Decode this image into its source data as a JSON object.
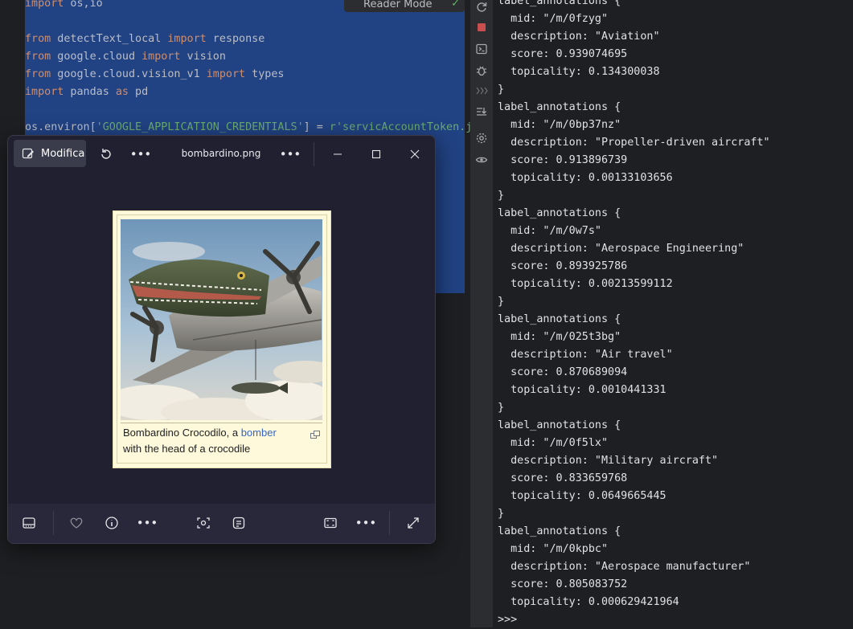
{
  "editor": {
    "code_lines": [
      [
        {
          "t": "import",
          "c": "kw"
        },
        {
          "t": " os,io",
          "c": ""
        }
      ],
      [],
      [
        {
          "t": "from",
          "c": "kw"
        },
        {
          "t": " detectText_local ",
          "c": ""
        },
        {
          "t": "import",
          "c": "kw"
        },
        {
          "t": " response",
          "c": ""
        }
      ],
      [
        {
          "t": "from",
          "c": "kw"
        },
        {
          "t": " google.cloud ",
          "c": ""
        },
        {
          "t": "import",
          "c": "kw"
        },
        {
          "t": " vision",
          "c": ""
        }
      ],
      [
        {
          "t": "from",
          "c": "kw"
        },
        {
          "t": " google.cloud.vision_v1 ",
          "c": ""
        },
        {
          "t": "import",
          "c": "kw"
        },
        {
          "t": " types",
          "c": ""
        }
      ],
      [
        {
          "t": "import",
          "c": "kw"
        },
        {
          "t": " pandas ",
          "c": ""
        },
        {
          "t": "as",
          "c": "kw"
        },
        {
          "t": " pd",
          "c": ""
        }
      ],
      [],
      [
        {
          "t": "os.environ[",
          "c": ""
        },
        {
          "t": "'GOOGLE_APPLICATION_CREDENTIALS'",
          "c": "str"
        },
        {
          "t": "] = ",
          "c": ""
        },
        {
          "t": "r'servicAccountToken.j",
          "c": "str"
        }
      ]
    ],
    "reader_mode_label": "Reader Mode",
    "colors": {
      "keyword": "#cf8e6d",
      "string": "#6aab73",
      "selection": "#214283"
    }
  },
  "toolstrip": {
    "icons": [
      "rerun-icon",
      "stop-icon",
      "console-icon",
      "debug-icon",
      "more-tools-icon",
      "scroll-to-end-icon",
      "settings-icon",
      "view-icon"
    ]
  },
  "console": {
    "lines": [
      "label_annotations {",
      "  mid: \"/m/0fzyg\"",
      "  description: \"Aviation\"",
      "  score: 0.939074695",
      "  topicality: 0.134300038",
      "}",
      "label_annotations {",
      "  mid: \"/m/0bp37nz\"",
      "  description: \"Propeller-driven aircraft\"",
      "  score: 0.913896739",
      "  topicality: 0.00133103656",
      "}",
      "label_annotations {",
      "  mid: \"/m/0w7s\"",
      "  description: \"Aerospace Engineering\"",
      "  score: 0.893925786",
      "  topicality: 0.00213599112",
      "}",
      "label_annotations {",
      "  mid: \"/m/025t3bg\"",
      "  description: \"Air travel\"",
      "  score: 0.870689094",
      "  topicality: 0.0010441331",
      "}",
      "label_annotations {",
      "  mid: \"/m/0f5lx\"",
      "  description: \"Military aircraft\"",
      "  score: 0.833659768",
      "  topicality: 0.0649665445",
      "}",
      "label_annotations {",
      "  mid: \"/m/0kpbc\"",
      "  description: \"Aerospace manufacturer\"",
      "  score: 0.805083752",
      "  topicality: 0.000629421964",
      ">>>"
    ]
  },
  "viewer": {
    "edit_label": "Modifica",
    "filename": "bombardino.png",
    "caption_pre": "Bombardino Crocodilo, a ",
    "caption_link": "bomber",
    "caption_post": "with the head of a crocodile"
  }
}
